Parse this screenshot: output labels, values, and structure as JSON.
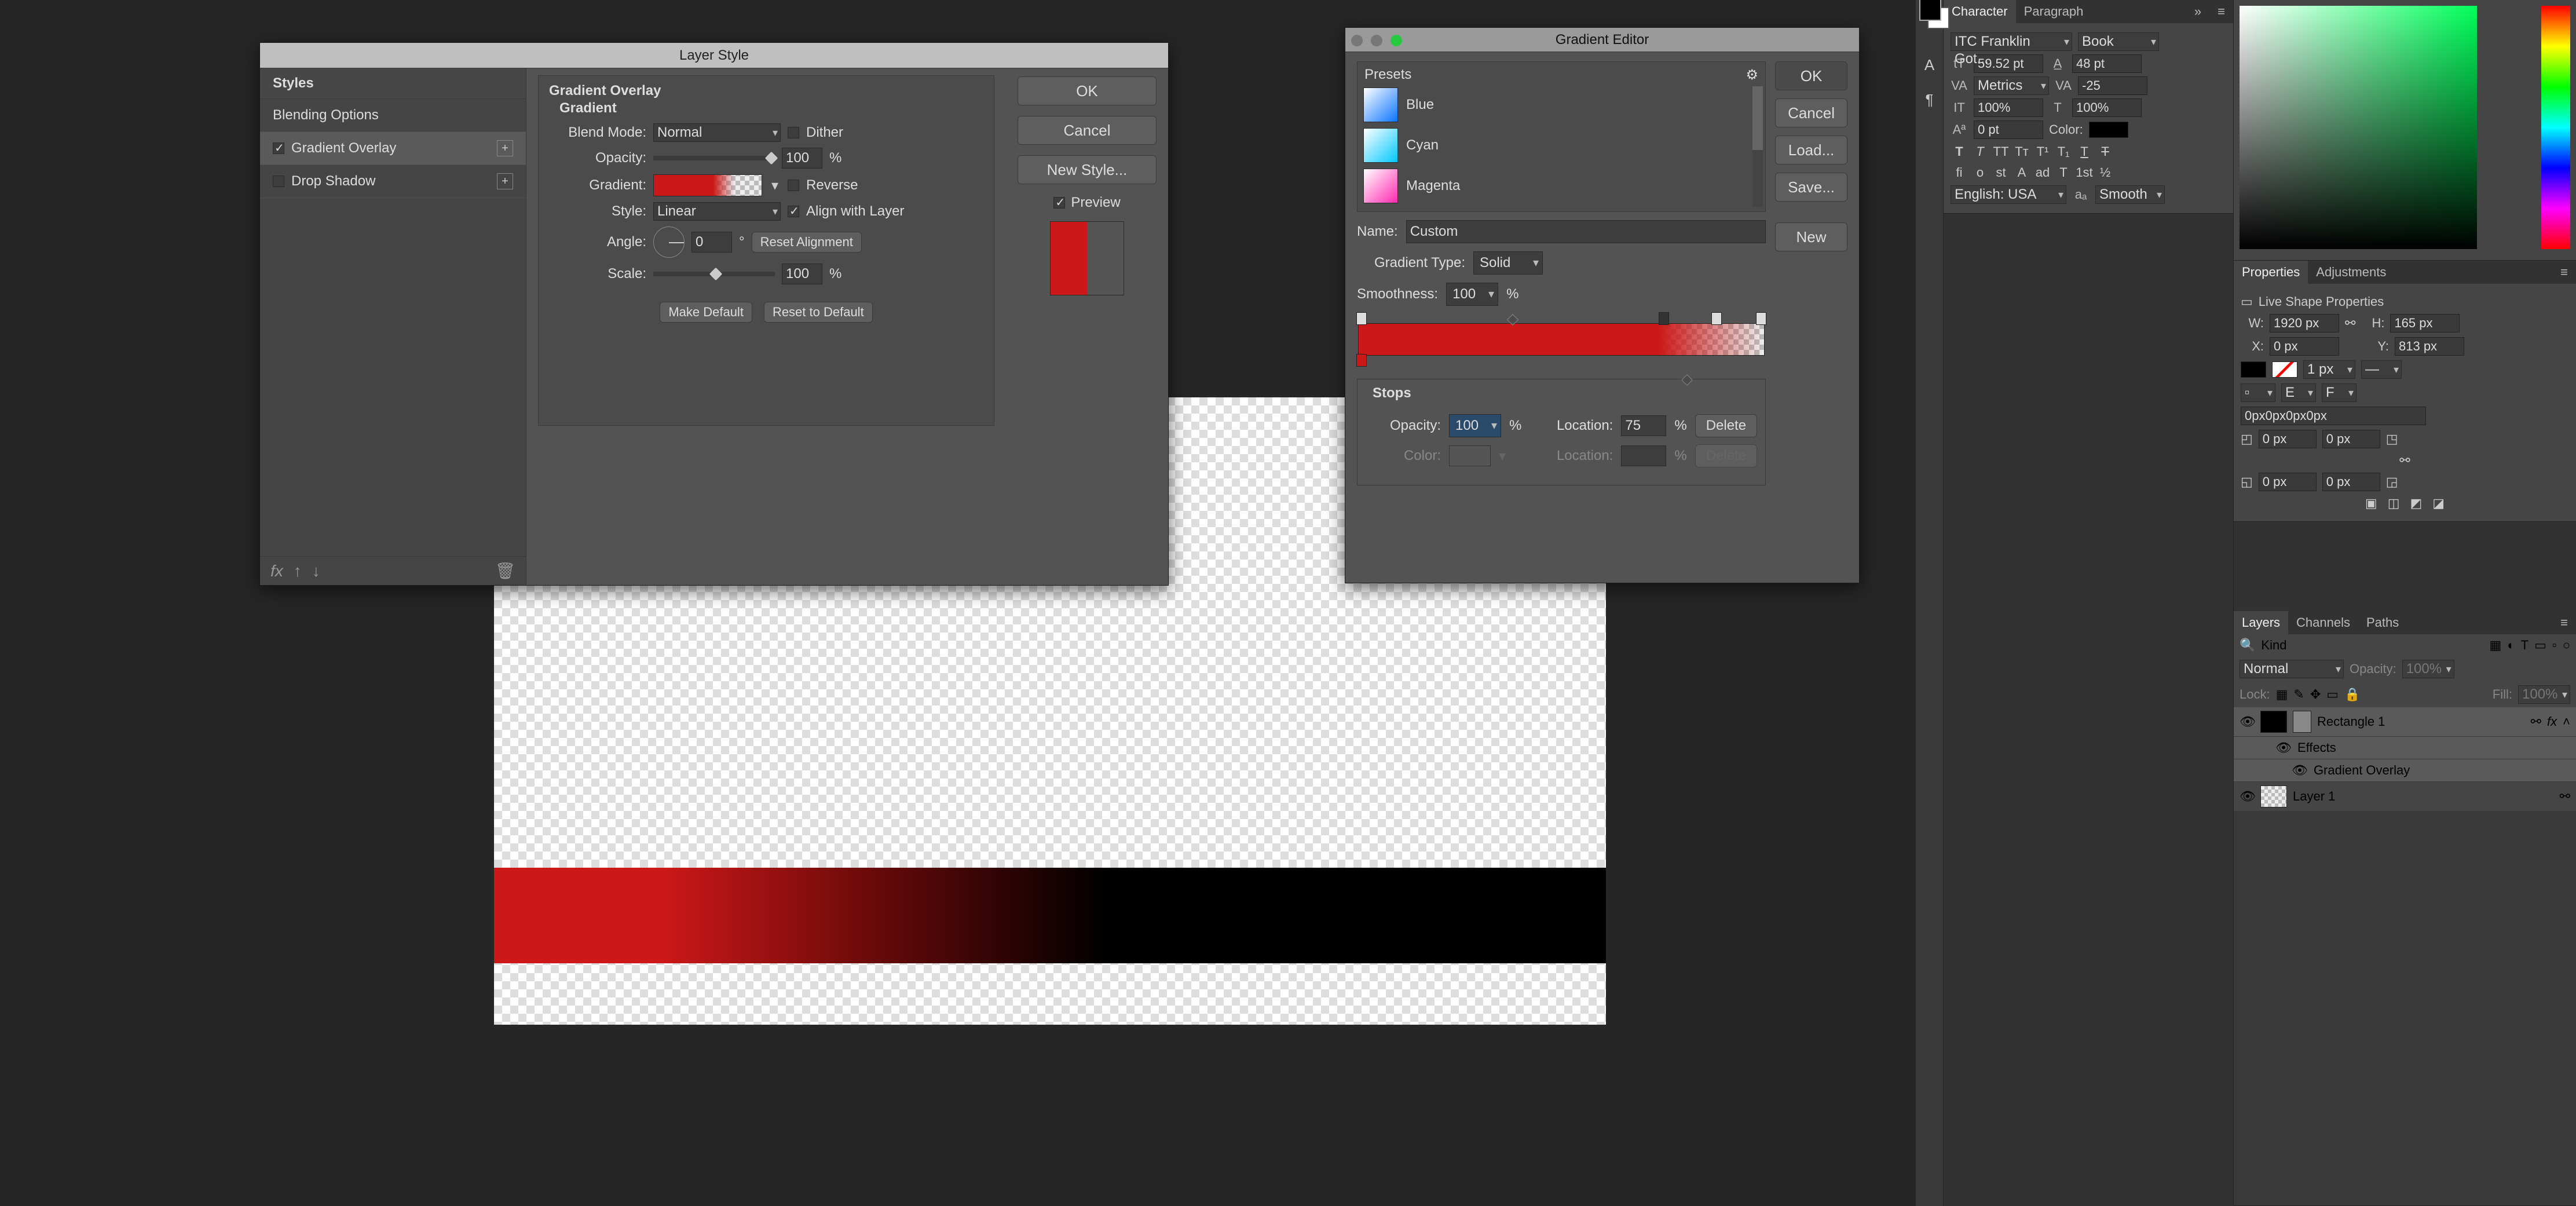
{
  "layerStyle": {
    "title": "Layer Style",
    "side": {
      "header": "Styles",
      "items": [
        {
          "label": "Blending Options",
          "checkbox": false,
          "checked": false,
          "add": false
        },
        {
          "label": "Gradient Overlay",
          "checkbox": true,
          "checked": true,
          "add": true,
          "selected": true
        },
        {
          "label": "Drop Shadow",
          "checkbox": true,
          "checked": false,
          "add": true
        }
      ],
      "foot": [
        "fx",
        "↑",
        "↓",
        "🗑"
      ]
    },
    "main": {
      "heading": "Gradient Overlay",
      "subheading": "Gradient",
      "blendMode": {
        "label": "Blend Mode:",
        "value": "Normal"
      },
      "dither": {
        "label": "Dither",
        "checked": false
      },
      "opacity": {
        "label": "Opacity:",
        "value": "100",
        "unit": "%"
      },
      "gradient": {
        "label": "Gradient:"
      },
      "reverse": {
        "label": "Reverse",
        "checked": false
      },
      "style": {
        "label": "Style:",
        "value": "Linear"
      },
      "align": {
        "label": "Align with Layer",
        "checked": true
      },
      "angle": {
        "label": "Angle:",
        "value": "0",
        "unit": "°",
        "reset": "Reset Alignment"
      },
      "scale": {
        "label": "Scale:",
        "value": "100",
        "unit": "%"
      },
      "makeDefault": "Make Default",
      "resetDefault": "Reset to Default"
    },
    "right": {
      "ok": "OK",
      "cancel": "Cancel",
      "newStyle": "New Style...",
      "preview": {
        "label": "Preview",
        "checked": true
      }
    }
  },
  "gradientEditor": {
    "title": "Gradient Editor",
    "presets": {
      "header": "Presets",
      "items": [
        {
          "name": "Blue",
          "grad": "linear-gradient(135deg,#ffffff,#0a74ff)"
        },
        {
          "name": "Cyan",
          "grad": "linear-gradient(135deg,#ffffff,#00c8ff)"
        },
        {
          "name": "Magenta",
          "grad": "linear-gradient(135deg,#ffffff,#ff2ab0)"
        }
      ]
    },
    "buttons": {
      "ok": "OK",
      "cancel": "Cancel",
      "load": "Load...",
      "save": "Save...",
      "new": "New"
    },
    "name": {
      "label": "Name:",
      "value": "Custom"
    },
    "type": {
      "label": "Gradient Type:",
      "value": "Solid"
    },
    "smoothness": {
      "label": "Smoothness:",
      "value": "100",
      "unit": "%"
    },
    "stops": {
      "header": "Stops",
      "opacity": {
        "label": "Opacity:",
        "value": "100",
        "unit": "%"
      },
      "location1": {
        "label": "Location:",
        "value": "75",
        "unit": "%"
      },
      "delete1": "Delete",
      "color": {
        "label": "Color:"
      },
      "location2": {
        "label": "Location:",
        "value": "",
        "unit": "%"
      },
      "delete2": "Delete"
    }
  },
  "character": {
    "tab1": "Character",
    "tab2": "Paragraph",
    "font": "ITC Franklin Got...",
    "weight": "Book",
    "size": "59.52 pt",
    "leading": "48 pt",
    "metrics": "Metrics",
    "tracking": "-25",
    "vscale": "100%",
    "hscale": "100%",
    "baseline": "0 pt",
    "colorLabel": "Color:",
    "lang": "English: USA",
    "aa": "Smooth"
  },
  "properties": {
    "tab1": "Properties",
    "tab2": "Adjustments",
    "title": "Live Shape Properties",
    "w": {
      "label": "W:",
      "value": "1920 px"
    },
    "h": {
      "label": "H:",
      "value": "165 px"
    },
    "x": {
      "label": "X:",
      "value": "0 px"
    },
    "y": {
      "label": "Y:",
      "value": "813 px"
    },
    "stroke": "1 px",
    "corners": "0px0px0px0px",
    "corner_vals": [
      "0 px",
      "0 px",
      "0 px",
      "0 px"
    ]
  },
  "layers": {
    "tab1": "Layers",
    "tab2": "Channels",
    "tab3": "Paths",
    "kind": "Kind",
    "blend": "Normal",
    "opacityLabel": "Opacity:",
    "opacity": "100%",
    "lockLabel": "Lock:",
    "fillLabel": "Fill:",
    "fill": "100%",
    "items": [
      {
        "name": "Rectangle 1",
        "active": true,
        "fx": true
      },
      {
        "name": "Effects",
        "sub": true
      },
      {
        "name": "Gradient Overlay",
        "sub2": true
      },
      {
        "name": "Layer 1"
      }
    ]
  }
}
